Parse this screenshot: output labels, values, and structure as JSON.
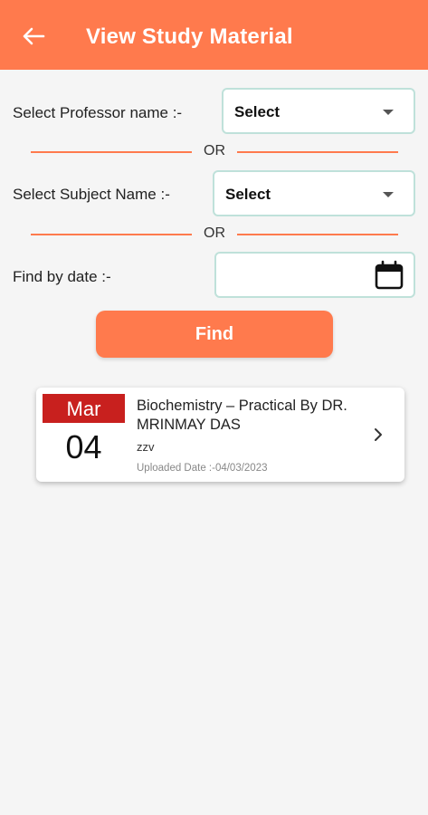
{
  "appbar": {
    "title": "View Study Material"
  },
  "filters": {
    "professor_label": "Select Professor name  :-",
    "professor_value": "Select",
    "or_text_1": "OR",
    "subject_label": "Select Subject Name   :-",
    "subject_value": "Select",
    "or_text_2": "OR",
    "date_label": "Find by date  :-",
    "date_value": ""
  },
  "find_button": {
    "label": "Find"
  },
  "materials": [
    {
      "month": "Mar",
      "day": "04",
      "title": "Biochemistry – Practical By DR. MRINMAY DAS",
      "description": "zzv",
      "uploaded": "Uploaded Date :-04/03/2023"
    }
  ],
  "colors": {
    "primary": "#ff7a4d",
    "badge_red": "#c8201e",
    "field_border": "#bfe1da"
  },
  "icons": {
    "back": "arrow-left-icon",
    "dropdown": "caret-down-icon",
    "calendar": "calendar-icon",
    "chevron": "chevron-right-icon"
  }
}
